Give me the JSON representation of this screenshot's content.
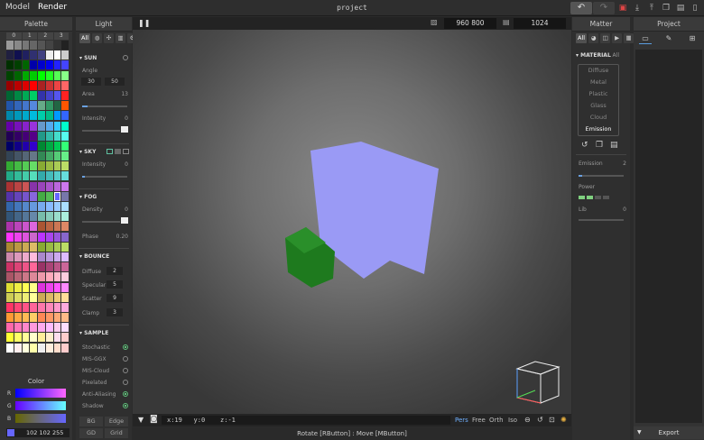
{
  "app": {
    "menu": [
      "Model",
      "Render"
    ],
    "active_menu": "Render",
    "project_name": "project"
  },
  "panels": {
    "palette": "Palette",
    "light": "Light",
    "matter": "Matter",
    "project": "Project"
  },
  "palette": {
    "tabs": [
      "0",
      "1",
      "2",
      "3"
    ],
    "selected_color": "#6666ff",
    "color_section": {
      "title": "Color",
      "channels": [
        "R",
        "G",
        "B"
      ],
      "rgb": "102 102 255"
    }
  },
  "light": {
    "filter_all": "All",
    "sun": {
      "title": "SUN",
      "angle_label": "Angle",
      "angle_a": "30",
      "angle_b": "50",
      "area_label": "Area",
      "area_value": "13",
      "intensity_label": "Intensity",
      "intensity_value": "0"
    },
    "sky": {
      "title": "SKY",
      "intensity_label": "Intensity",
      "intensity_value": "0"
    },
    "fog": {
      "title": "FOG",
      "density_label": "Density",
      "density_value": "0",
      "phase_label": "Phase",
      "phase_value": "0.20"
    },
    "bounce": {
      "title": "BOUNCE",
      "rows": [
        {
          "label": "Diffuse",
          "value": "2"
        },
        {
          "label": "Specular",
          "value": "5"
        },
        {
          "label": "Scatter",
          "value": "9"
        },
        {
          "label": "Clamp",
          "value": "3"
        }
      ]
    },
    "sample": {
      "title": "SAMPLE",
      "rows": [
        {
          "label": "Stochastic",
          "on": true
        },
        {
          "label": "MIS-GGX",
          "on": false
        },
        {
          "label": "MIS-Cloud",
          "on": false
        },
        {
          "label": "Pixelated",
          "on": false
        },
        {
          "label": "Anti-Aliasing",
          "on": true
        },
        {
          "label": "Shadow",
          "on": true
        }
      ]
    },
    "footer_buttons": [
      "BG",
      "Edge",
      "GD",
      "Grid"
    ]
  },
  "viewport": {
    "resolution_w": "960",
    "resolution_h": "800",
    "samples": "1024",
    "coords": {
      "x": "x:19",
      "y": "y:0",
      "z": "z:-1"
    },
    "view_modes": [
      "Pers",
      "Free",
      "Orth",
      "Iso"
    ],
    "active_view_mode": "Pers",
    "status": "Rotate [RButton] : Move [MButton]",
    "cube_color": "#9a9af5",
    "small_cube_color": "#1e7a1e"
  },
  "matter": {
    "filter_all": "All",
    "section_title": "MATERIAL",
    "section_all": "All",
    "types": [
      "Diffuse",
      "Metal",
      "Plastic",
      "Glass",
      "Cloud",
      "Emission"
    ],
    "active_type": "Emission",
    "emission_label": "Emission",
    "emission_value": "2",
    "power_label": "Power",
    "lib_label": "Lib",
    "lib_value": "0"
  },
  "project": {
    "export_label": "Export"
  }
}
